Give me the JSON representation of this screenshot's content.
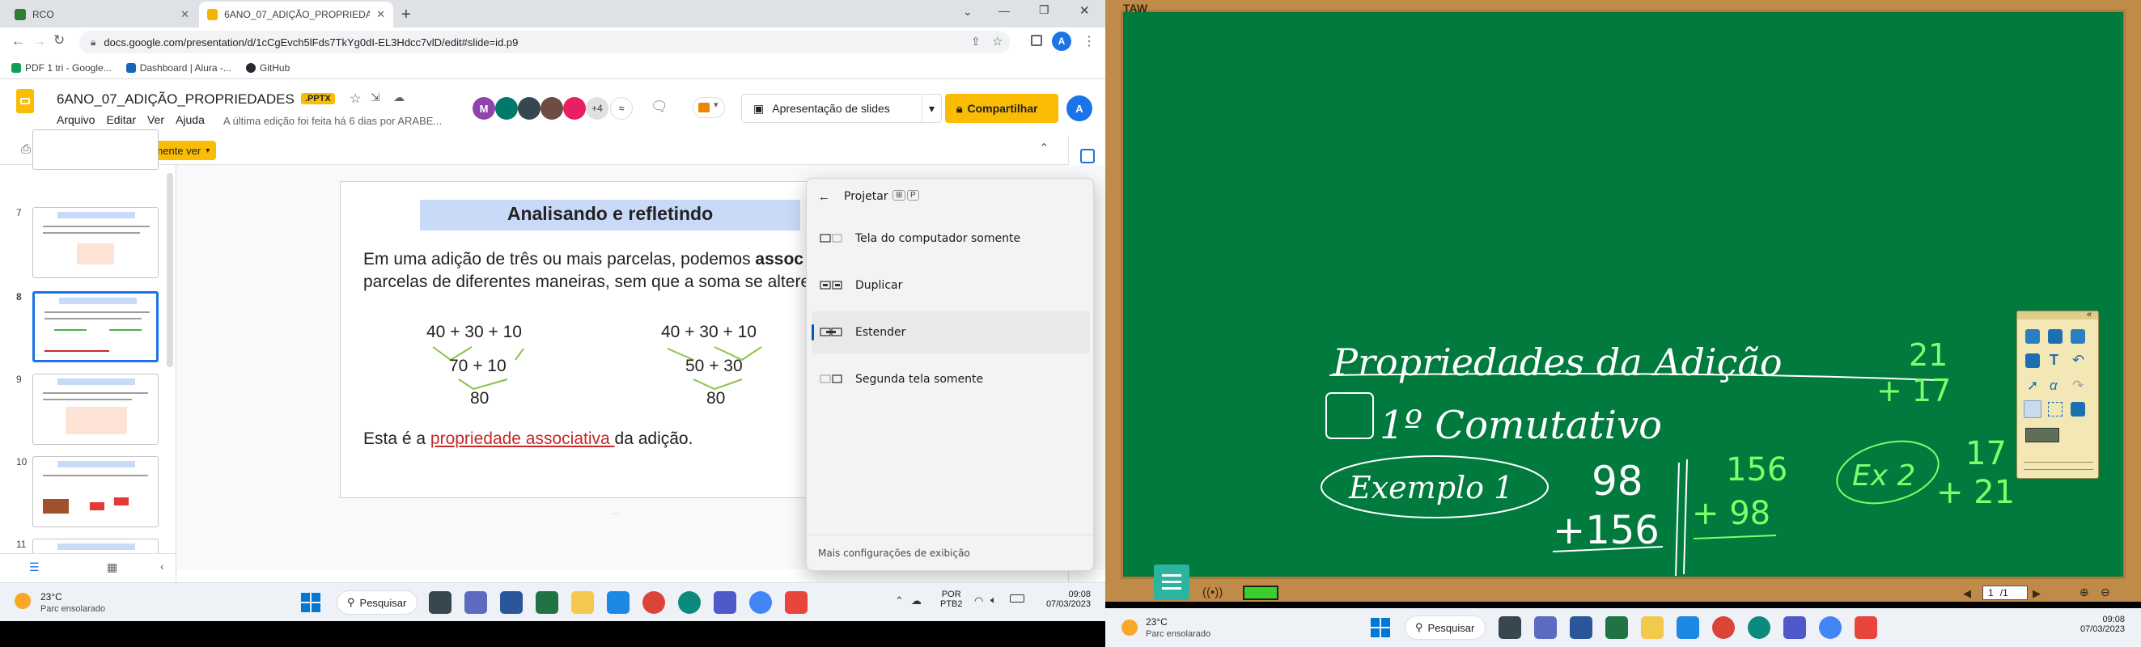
{
  "browser": {
    "tabs": [
      {
        "label": "RCO"
      },
      {
        "label": "6ANO_07_ADIÇÃO_PROPRIEDADES"
      }
    ],
    "url": "docs.google.com/presentation/d/1cCgEvch5lFds7TkYg0dI-EL3Hdcc7vlD/edit#slide=id.p9",
    "bookmarks": [
      "PDF 1 tri - Google...",
      "Dashboard | Alura -...",
      "GitHub"
    ],
    "profile_letter": "A"
  },
  "slides_app": {
    "doc_title": "6ANO_07_ADIÇÃO_PROPRIEDADES",
    "badge": ".PPTX",
    "menu": [
      "Arquivo",
      "Editar",
      "Ver",
      "Ajuda"
    ],
    "last_edit": "A última edição foi feita há 6 dias por ARABE...",
    "collab_extra": "+4",
    "present_label": "Apresentação de slides",
    "share_label": "Compartilhar",
    "view_mode": "Somente ver",
    "colors": {
      "accent_yellow": "#fbbc04",
      "share_bg": "#fbbc04"
    }
  },
  "filmstrip": {
    "slide_numbers": [
      "7",
      "8",
      "9",
      "10",
      "11"
    ],
    "thumb_titles": [
      "Analisando e refletindo",
      "Analisando e refletindo",
      "Apresentando mais uma propriedade",
      "Praticando | parte 1",
      "Praticando | parte 1"
    ]
  },
  "slide": {
    "title": "Analisando e refletindo",
    "paragraph_l1_a": "Em uma adição de três ou mais parcelas, podemos ",
    "paragraph_l1_b": "assoc",
    "paragraph_l2": "parcelas de diferentes maneiras, sem que a soma se altere",
    "left_expr": "40 + 30 + 10",
    "left_mid": "70 + 10",
    "left_res": "80",
    "right_expr": "40 + 30 + 10",
    "right_mid": "50 + 30",
    "right_res": "80",
    "footer_a": "Esta é a ",
    "footer_link": "propriedade associativa ",
    "footer_b": "da adição."
  },
  "project_panel": {
    "title": "Projetar",
    "shortcut": "P",
    "options": [
      "Tela do computador somente",
      "Duplicar",
      "Estender",
      "Segunda tela somente"
    ],
    "selected": "Estender",
    "footer": "Mais configurações de exibição"
  },
  "taskbar_left": {
    "temp": "23°C",
    "weather": "Parc ensolarado",
    "search": "Pesquisar",
    "lang1": "POR",
    "lang2": "PTB2",
    "time": "09:08",
    "date": "07/03/2023"
  },
  "whiteboard": {
    "app_label": "TAW",
    "heading": "Propriedades da Adição",
    "item": "1º Comutativo",
    "example_label": "Exemplo 1",
    "ex1_top": "98",
    "ex1_bottom": "+156",
    "ex1b_top": "156",
    "ex1b_bottom": "+ 98",
    "ex2_label": "Ex 2",
    "ex2_top": "17",
    "ex2_bottom": "+ 21",
    "side_top": "21",
    "side_bottom": "+ 17",
    "page_current": "1",
    "page_total": "/1",
    "colors": {
      "board": "#007a3d",
      "chalk": "#ffffff",
      "marker_green": "#7cff6a"
    }
  },
  "taskbar_right": {
    "temp": "23°C",
    "weather": "Parc ensolarado",
    "search": "Pesquisar",
    "time": "09:08",
    "date": "07/03/2023"
  }
}
